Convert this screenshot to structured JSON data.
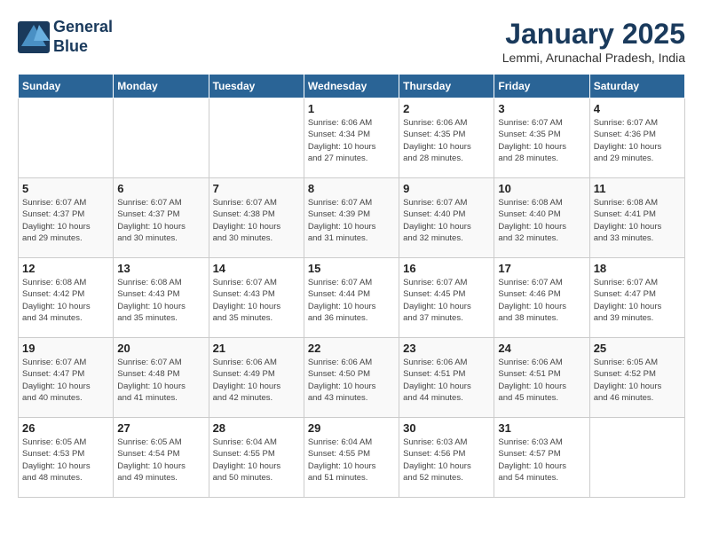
{
  "header": {
    "logo_line1": "General",
    "logo_line2": "Blue",
    "month": "January 2025",
    "location": "Lemmi, Arunachal Pradesh, India"
  },
  "days_of_week": [
    "Sunday",
    "Monday",
    "Tuesday",
    "Wednesday",
    "Thursday",
    "Friday",
    "Saturday"
  ],
  "weeks": [
    [
      {
        "day": "",
        "info": ""
      },
      {
        "day": "",
        "info": ""
      },
      {
        "day": "",
        "info": ""
      },
      {
        "day": "1",
        "info": "Sunrise: 6:06 AM\nSunset: 4:34 PM\nDaylight: 10 hours\nand 27 minutes."
      },
      {
        "day": "2",
        "info": "Sunrise: 6:06 AM\nSunset: 4:35 PM\nDaylight: 10 hours\nand 28 minutes."
      },
      {
        "day": "3",
        "info": "Sunrise: 6:07 AM\nSunset: 4:35 PM\nDaylight: 10 hours\nand 28 minutes."
      },
      {
        "day": "4",
        "info": "Sunrise: 6:07 AM\nSunset: 4:36 PM\nDaylight: 10 hours\nand 29 minutes."
      }
    ],
    [
      {
        "day": "5",
        "info": "Sunrise: 6:07 AM\nSunset: 4:37 PM\nDaylight: 10 hours\nand 29 minutes."
      },
      {
        "day": "6",
        "info": "Sunrise: 6:07 AM\nSunset: 4:37 PM\nDaylight: 10 hours\nand 30 minutes."
      },
      {
        "day": "7",
        "info": "Sunrise: 6:07 AM\nSunset: 4:38 PM\nDaylight: 10 hours\nand 30 minutes."
      },
      {
        "day": "8",
        "info": "Sunrise: 6:07 AM\nSunset: 4:39 PM\nDaylight: 10 hours\nand 31 minutes."
      },
      {
        "day": "9",
        "info": "Sunrise: 6:07 AM\nSunset: 4:40 PM\nDaylight: 10 hours\nand 32 minutes."
      },
      {
        "day": "10",
        "info": "Sunrise: 6:08 AM\nSunset: 4:40 PM\nDaylight: 10 hours\nand 32 minutes."
      },
      {
        "day": "11",
        "info": "Sunrise: 6:08 AM\nSunset: 4:41 PM\nDaylight: 10 hours\nand 33 minutes."
      }
    ],
    [
      {
        "day": "12",
        "info": "Sunrise: 6:08 AM\nSunset: 4:42 PM\nDaylight: 10 hours\nand 34 minutes."
      },
      {
        "day": "13",
        "info": "Sunrise: 6:08 AM\nSunset: 4:43 PM\nDaylight: 10 hours\nand 35 minutes."
      },
      {
        "day": "14",
        "info": "Sunrise: 6:07 AM\nSunset: 4:43 PM\nDaylight: 10 hours\nand 35 minutes."
      },
      {
        "day": "15",
        "info": "Sunrise: 6:07 AM\nSunset: 4:44 PM\nDaylight: 10 hours\nand 36 minutes."
      },
      {
        "day": "16",
        "info": "Sunrise: 6:07 AM\nSunset: 4:45 PM\nDaylight: 10 hours\nand 37 minutes."
      },
      {
        "day": "17",
        "info": "Sunrise: 6:07 AM\nSunset: 4:46 PM\nDaylight: 10 hours\nand 38 minutes."
      },
      {
        "day": "18",
        "info": "Sunrise: 6:07 AM\nSunset: 4:47 PM\nDaylight: 10 hours\nand 39 minutes."
      }
    ],
    [
      {
        "day": "19",
        "info": "Sunrise: 6:07 AM\nSunset: 4:47 PM\nDaylight: 10 hours\nand 40 minutes."
      },
      {
        "day": "20",
        "info": "Sunrise: 6:07 AM\nSunset: 4:48 PM\nDaylight: 10 hours\nand 41 minutes."
      },
      {
        "day": "21",
        "info": "Sunrise: 6:06 AM\nSunset: 4:49 PM\nDaylight: 10 hours\nand 42 minutes."
      },
      {
        "day": "22",
        "info": "Sunrise: 6:06 AM\nSunset: 4:50 PM\nDaylight: 10 hours\nand 43 minutes."
      },
      {
        "day": "23",
        "info": "Sunrise: 6:06 AM\nSunset: 4:51 PM\nDaylight: 10 hours\nand 44 minutes."
      },
      {
        "day": "24",
        "info": "Sunrise: 6:06 AM\nSunset: 4:51 PM\nDaylight: 10 hours\nand 45 minutes."
      },
      {
        "day": "25",
        "info": "Sunrise: 6:05 AM\nSunset: 4:52 PM\nDaylight: 10 hours\nand 46 minutes."
      }
    ],
    [
      {
        "day": "26",
        "info": "Sunrise: 6:05 AM\nSunset: 4:53 PM\nDaylight: 10 hours\nand 48 minutes."
      },
      {
        "day": "27",
        "info": "Sunrise: 6:05 AM\nSunset: 4:54 PM\nDaylight: 10 hours\nand 49 minutes."
      },
      {
        "day": "28",
        "info": "Sunrise: 6:04 AM\nSunset: 4:55 PM\nDaylight: 10 hours\nand 50 minutes."
      },
      {
        "day": "29",
        "info": "Sunrise: 6:04 AM\nSunset: 4:55 PM\nDaylight: 10 hours\nand 51 minutes."
      },
      {
        "day": "30",
        "info": "Sunrise: 6:03 AM\nSunset: 4:56 PM\nDaylight: 10 hours\nand 52 minutes."
      },
      {
        "day": "31",
        "info": "Sunrise: 6:03 AM\nSunset: 4:57 PM\nDaylight: 10 hours\nand 54 minutes."
      },
      {
        "day": "",
        "info": ""
      }
    ]
  ]
}
